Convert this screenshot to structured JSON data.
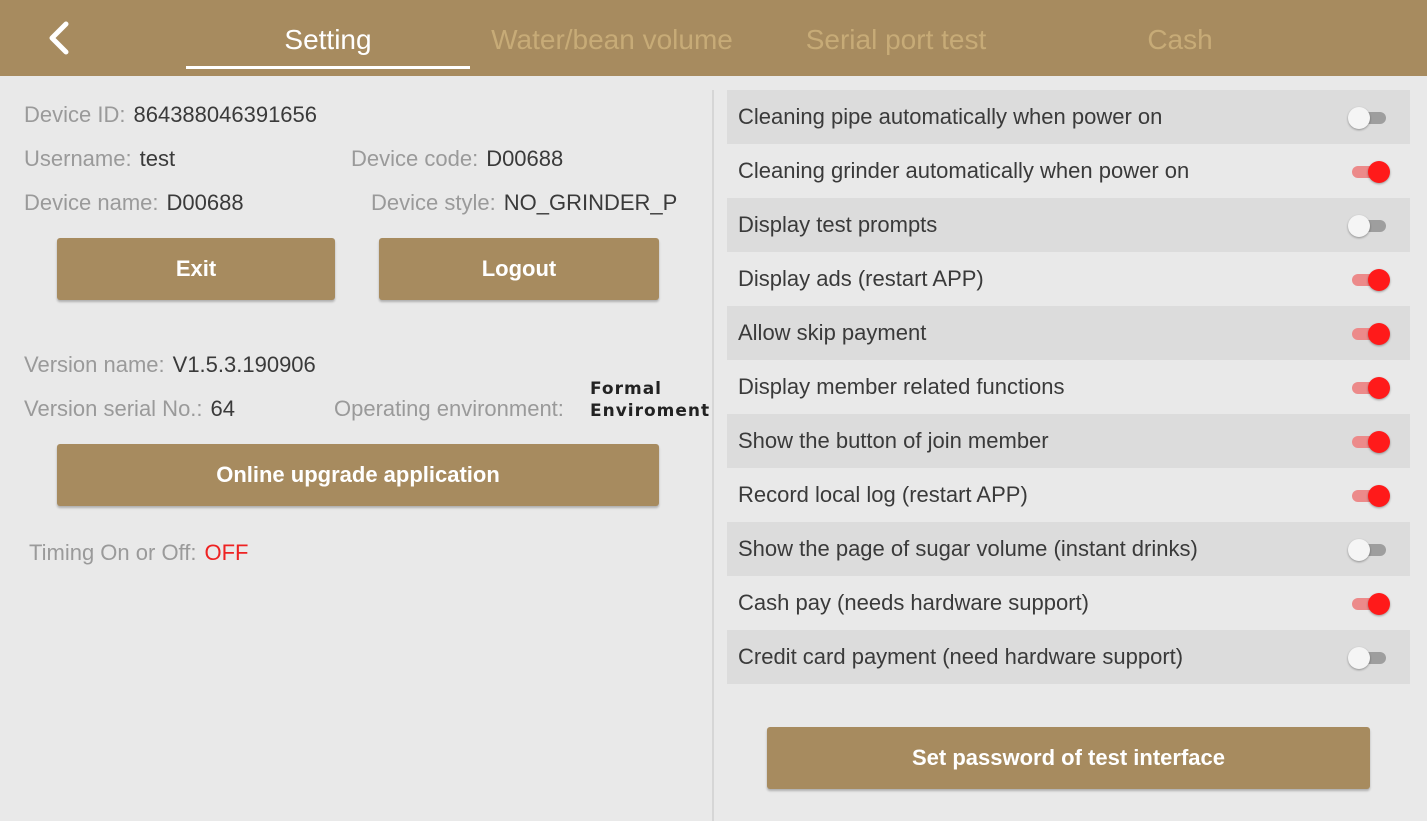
{
  "header": {
    "back_icon": "chevron-left-icon",
    "tabs": [
      {
        "label": "Setting",
        "active": true
      },
      {
        "label": "Water/bean volume",
        "active": false
      },
      {
        "label": "Serial port test",
        "active": false
      },
      {
        "label": "Cash",
        "active": false
      }
    ]
  },
  "device": {
    "id_label": "Device ID:",
    "id_value": "864388046391656",
    "username_label": "Username:",
    "username_value": "test",
    "code_label": "Device code:",
    "code_value": "D00688",
    "name_label": "Device name:",
    "name_value": "D00688",
    "style_label": "Device style:",
    "style_value": "NO_GRINDER_P"
  },
  "buttons": {
    "exit": "Exit",
    "logout": "Logout",
    "upgrade": "Online upgrade application",
    "set_password": "Set password of test interface"
  },
  "version": {
    "name_label": "Version name:",
    "name_value": "V1.5.3.190906",
    "serial_label": "Version serial No.:",
    "serial_value": "64",
    "env_label": "Operating environment:",
    "env_line1": "Formal",
    "env_line2": "Enviroment"
  },
  "timing": {
    "label": "Timing On or Off:",
    "value": "OFF"
  },
  "settings": [
    {
      "label": "Cleaning pipe automatically when power on",
      "on": false
    },
    {
      "label": "Cleaning grinder automatically when power on",
      "on": true
    },
    {
      "label": "Display test prompts",
      "on": false
    },
    {
      "label": "Display ads (restart APP)",
      "on": true
    },
    {
      "label": "Allow skip payment",
      "on": true
    },
    {
      "label": "Display member related functions",
      "on": true
    },
    {
      "label": "Show the button of join member",
      "on": true
    },
    {
      "label": "Record local log (restart APP)",
      "on": true
    },
    {
      "label": "Show the page of sugar volume (instant drinks)",
      "on": false
    },
    {
      "label": "Cash pay (needs hardware support)",
      "on": true
    },
    {
      "label": "Credit card payment (need hardware support)",
      "on": false
    }
  ],
  "colors": {
    "accent": "#a78b5f",
    "toggle_on": "#ff1a1a",
    "off_text": "#ee2222"
  }
}
